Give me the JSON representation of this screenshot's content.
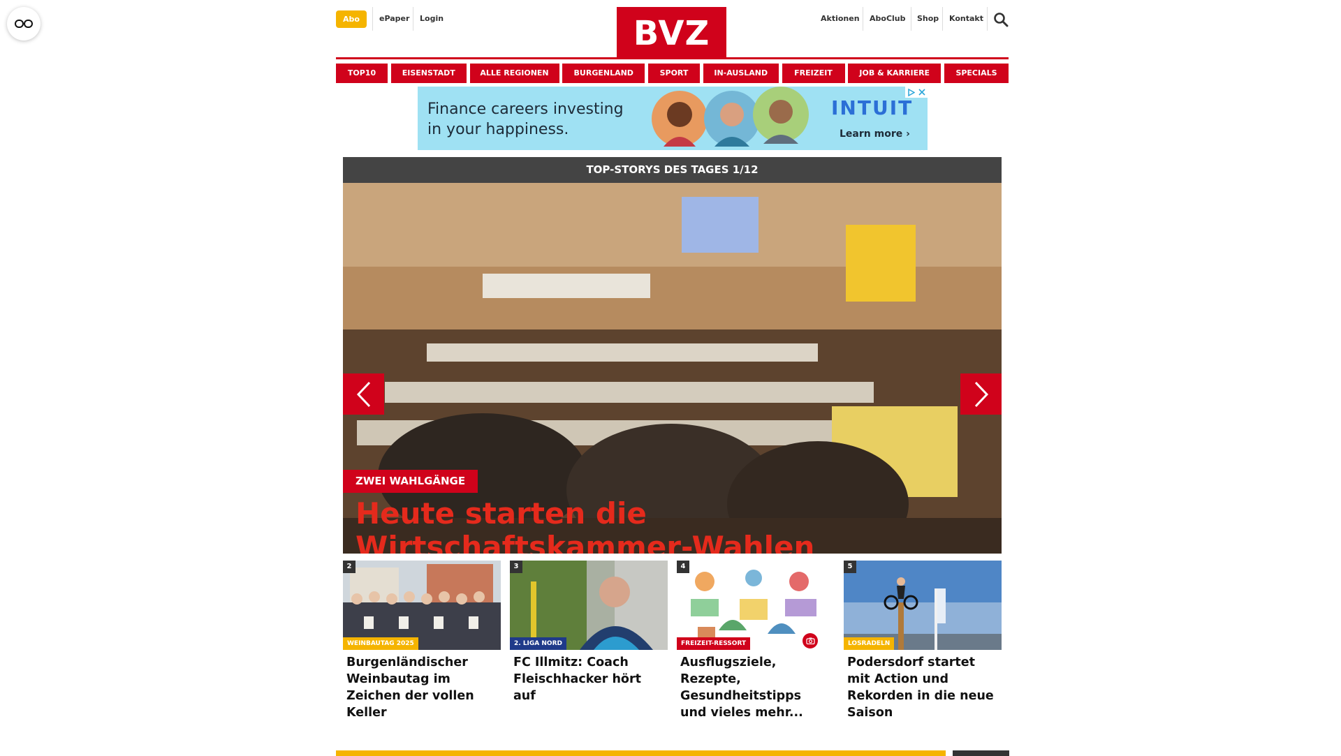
{
  "header": {
    "abo": "Abo",
    "epaper": "ePaper",
    "login": "Login",
    "logo": "BVZ",
    "links": [
      "Aktionen",
      "AboClub",
      "Shop",
      "Kontakt"
    ]
  },
  "nav": [
    "TOP10",
    "EISENSTADT",
    "ALLE REGIONEN",
    "BURGENLAND",
    "SPORT",
    "IN-AUSLAND",
    "FREIZEIT",
    "JOB & KARRIERE",
    "SPECIALS"
  ],
  "ad": {
    "line1": "Finance careers investing",
    "line2": "in your happiness.",
    "brand": "INTUIT",
    "cta": "Learn more ›"
  },
  "slider": {
    "title": "TOP-STORYS DES TAGES 1/12",
    "kicker": "ZWEI WAHLGÄNGE",
    "headline": "Heute starten die Wirtschaftskammer-Wahlen"
  },
  "cards": [
    {
      "num": "2",
      "tag": "WEINBAUTAG 2025",
      "title": "Burgenländischer Weinbautag im Zeichen der vollen Keller"
    },
    {
      "num": "3",
      "tag": "2. LIGA NORD",
      "title": "FC Illmitz: Coach Fleischhacker hört auf"
    },
    {
      "num": "4",
      "tag": "FREIZEIT-RESSORT",
      "title": "Ausflugsziele, Rezepte, Gesundheitstipps und vieles mehr..."
    },
    {
      "num": "5",
      "tag": "LOSRADELN",
      "title": "Podersdorf startet mit Action und Rekorden in die neue Saison"
    }
  ],
  "colors": {
    "brand_red": "#d0021b",
    "abo_yellow": "#f5b400",
    "headline_red": "#e52a1c",
    "tag_blue": "#1f3a8a"
  },
  "icons": [
    "reader-mode-icon",
    "search-icon",
    "chevron-left-icon",
    "chevron-right-icon",
    "camera-icon",
    "adchoices-icon",
    "close-icon"
  ]
}
